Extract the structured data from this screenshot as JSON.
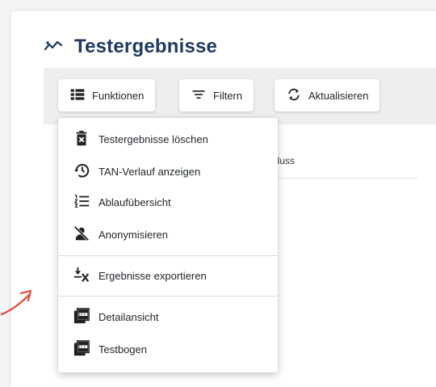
{
  "page": {
    "title": "Testergebnisse"
  },
  "toolbar": {
    "functions_label": "Funktionen",
    "filter_label": "Filtern",
    "refresh_label": "Aktualisieren"
  },
  "table": {
    "visible_header_fragment": "hluss"
  },
  "menu": {
    "items": [
      {
        "label": "Testergebnisse löschen",
        "icon": "delete-icon"
      },
      {
        "label": "TAN-Verlauf anzeigen",
        "icon": "history-icon"
      },
      {
        "label": "Ablaufübersicht",
        "icon": "list-numbered-icon"
      },
      {
        "label": "Anonymisieren",
        "icon": "anonymize-icon"
      },
      {
        "label": "Ergebnisse exportieren",
        "icon": "export-icon"
      },
      {
        "label": "Detailansicht",
        "icon": "pdf-icon"
      },
      {
        "label": "Testbogen",
        "icon": "pdf-icon"
      }
    ]
  },
  "colors": {
    "title": "#1f3a5f",
    "toolbar_background": "#eceef0",
    "annotation_arrow": "#e0564a"
  }
}
